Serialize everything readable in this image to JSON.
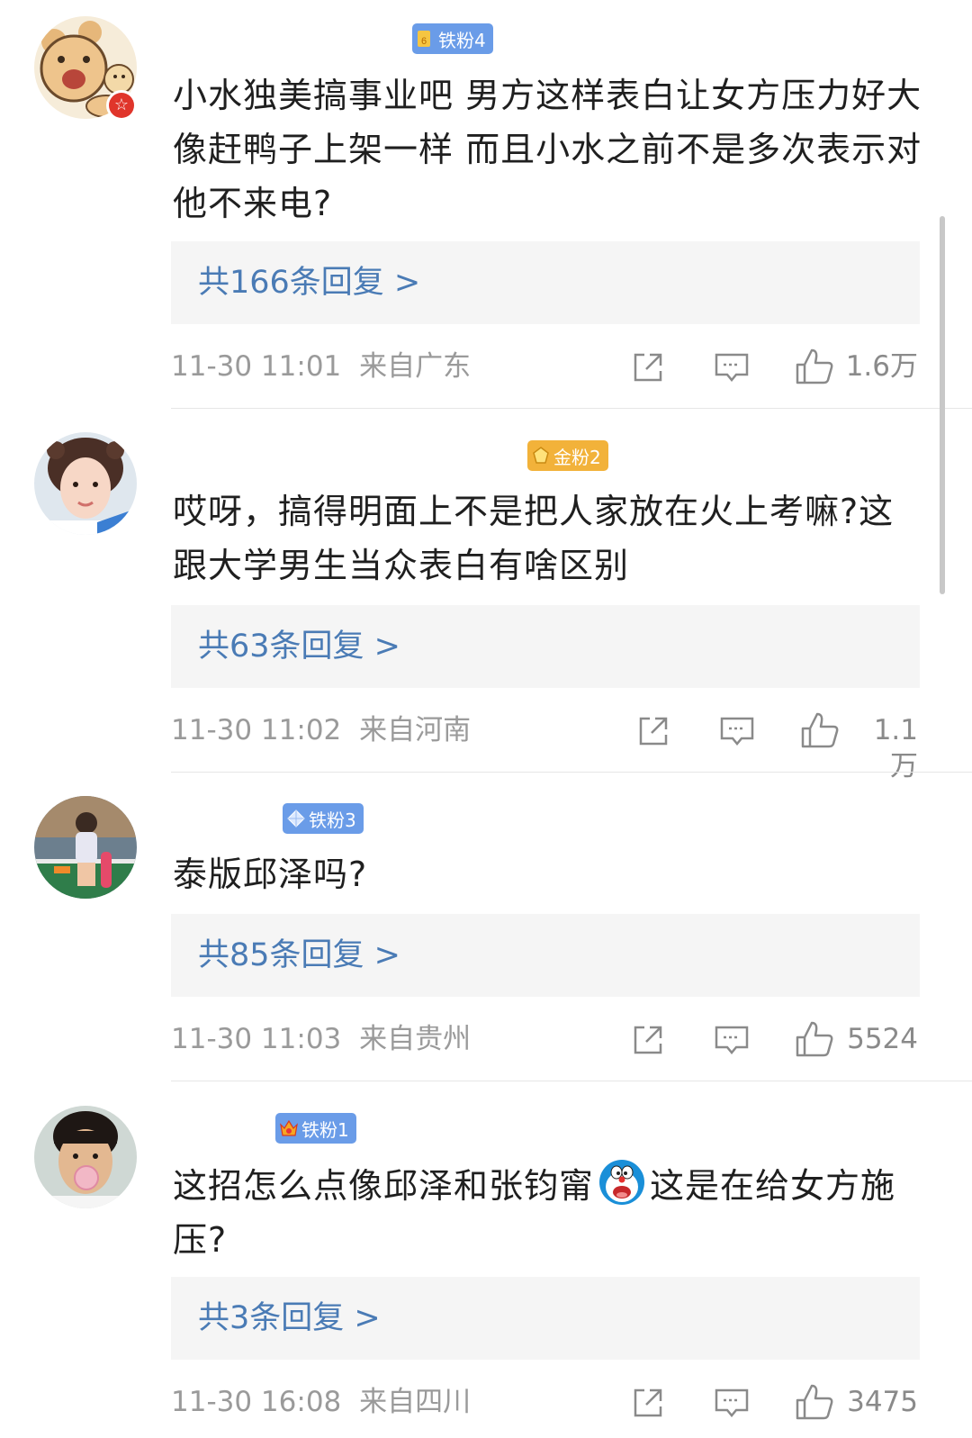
{
  "comments": [
    {
      "fan_badge": "铁粉4",
      "fan_color": "#6a9ce8",
      "text": "小水独美搞事业吧 男方这样表白让女方压力好大 像赶鸭子上架一样 而且小水之前不是多次表示对他不来电?",
      "replies": "共166条回复 >",
      "time": "11-30 11:01",
      "location": "来自广东",
      "likes": "1.6万",
      "verified_badge": "☆"
    },
    {
      "fan_badge": "金粉2",
      "fan_color": "#f2b23a",
      "text": "哎呀，搞得明面上不是把人家放在火上考嘛?这跟大学男生当众表白有啥区别",
      "replies": "共63条回复 >",
      "time": "11-30 11:02",
      "location": "来自河南",
      "likes": "1.1万"
    },
    {
      "fan_badge": "铁粉3",
      "fan_color": "#6a9ce8",
      "text": "泰版邱泽吗?",
      "replies": "共85条回复 >",
      "time": "11-30 11:03",
      "location": "来自贵州",
      "likes": "5524"
    },
    {
      "fan_badge": "铁粉1",
      "fan_color": "#6a9ce8",
      "text_before": "这招怎么点像邱泽和张钧甯",
      "text_after": "这是在给女方施压?",
      "replies": "共3条回复 >",
      "time": "11-30 16:08",
      "location": "来自四川",
      "likes": "3475"
    }
  ]
}
